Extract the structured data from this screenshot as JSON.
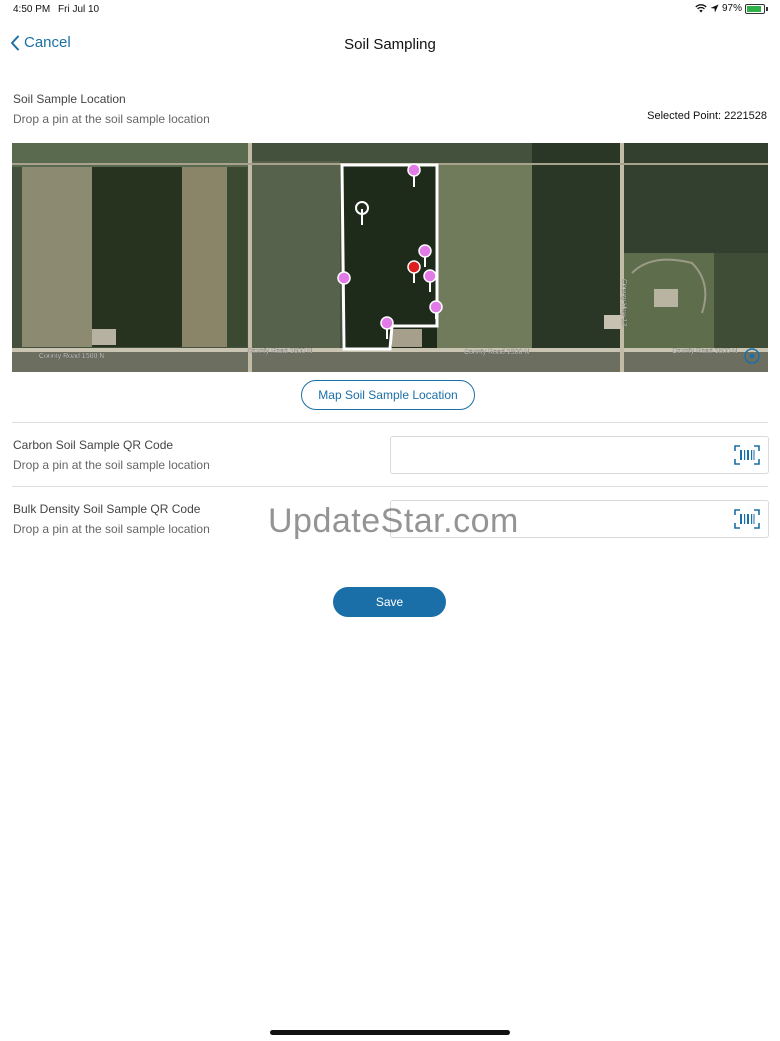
{
  "status": {
    "time": "4:50 PM",
    "date": "Fri Jul 10",
    "battery": "97%"
  },
  "nav": {
    "cancel_label": "Cancel",
    "title": "Soil Sampling"
  },
  "location": {
    "title": "Soil Sample Location",
    "subtitle": "Drop a pin at the soil sample location",
    "selected_point": "Selected Point: 2221528"
  },
  "map": {
    "road_labels": [
      "County Road 1500 N",
      "County Road 1500 N",
      "County Road 1500 N",
      "County Road 1500 N",
      "County Hwy 13"
    ],
    "button_label": "Map Soil Sample Location"
  },
  "carbon": {
    "title": "Carbon Soil Sample QR Code",
    "subtitle": "Drop a pin at the soil sample location",
    "value": ""
  },
  "bulk": {
    "title": "Bulk Density Soil Sample QR Code",
    "subtitle": "Drop a pin at the soil sample location",
    "value": ""
  },
  "watermark": "UpdateStar.com",
  "save_label": "Save",
  "colors": {
    "accent": "#1b6fa8",
    "pin_pink": "#e27be8",
    "pin_red": "#e01e1e"
  },
  "icons": [
    "chevron-left-icon",
    "wifi-icon",
    "location-arrow-icon",
    "battery-icon",
    "barcode-scan-icon",
    "locate-icon"
  ]
}
